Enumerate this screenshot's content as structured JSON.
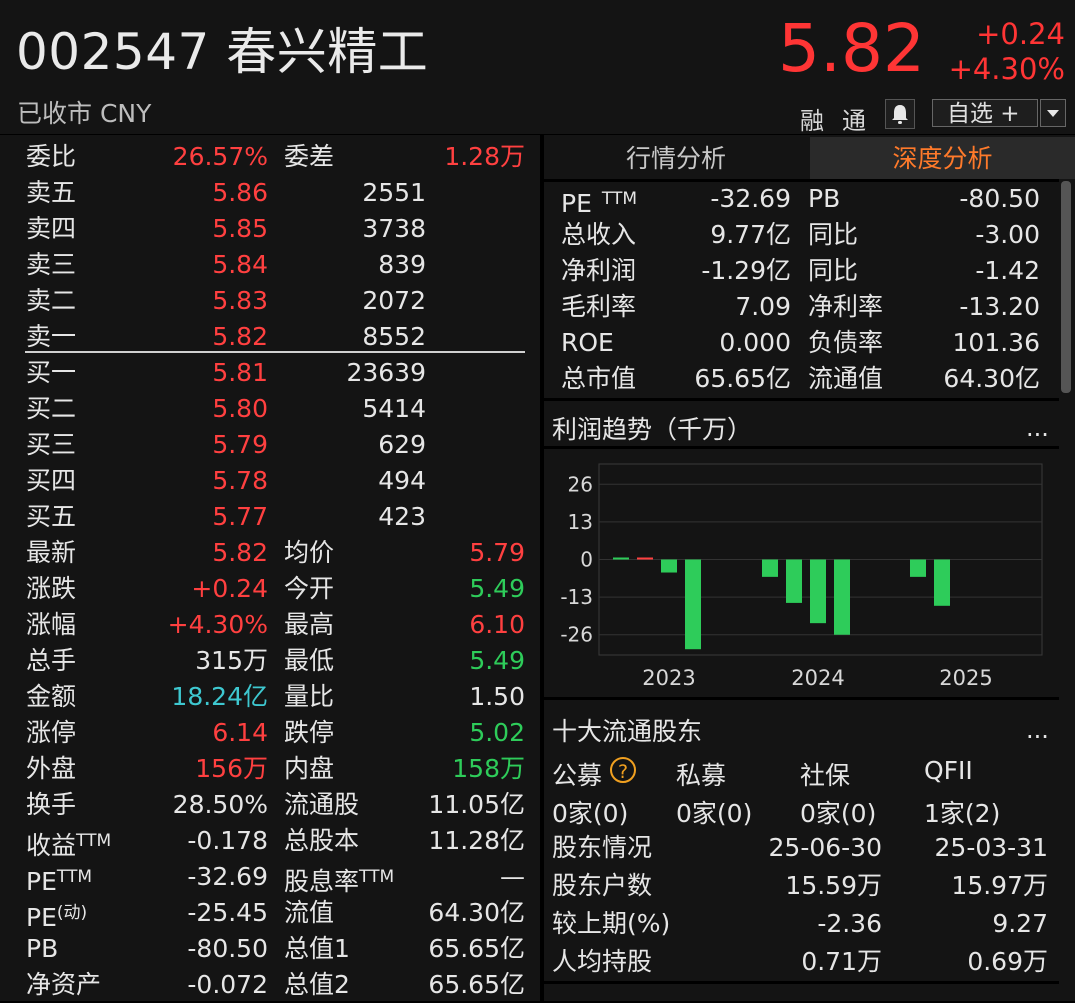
{
  "header": {
    "title": "002547 春兴精工",
    "subtitle": "已收市 CNY",
    "price": "5.82",
    "change": "+0.24",
    "change_pct": "+4.30%",
    "rong": "融",
    "tong": "通",
    "watchlist_label": "自选 +"
  },
  "book": {
    "weibi_label": "委比",
    "weibi_value": "26.57%",
    "weicha_label": "委差",
    "weicha_value": "1.28万",
    "asks": [
      {
        "label": "卖五",
        "price": "5.86",
        "qty": "2551"
      },
      {
        "label": "卖四",
        "price": "5.85",
        "qty": "3738"
      },
      {
        "label": "卖三",
        "price": "5.84",
        "qty": "839"
      },
      {
        "label": "卖二",
        "price": "5.83",
        "qty": "2072"
      },
      {
        "label": "卖一",
        "price": "5.82",
        "qty": "8552"
      }
    ],
    "bids": [
      {
        "label": "买一",
        "price": "5.81",
        "qty": "23639"
      },
      {
        "label": "买二",
        "price": "5.80",
        "qty": "5414"
      },
      {
        "label": "买三",
        "price": "5.79",
        "qty": "629"
      },
      {
        "label": "买四",
        "price": "5.78",
        "qty": "494"
      },
      {
        "label": "买五",
        "price": "5.77",
        "qty": "423"
      }
    ]
  },
  "stats": [
    {
      "l1": "最新",
      "v1": "5.82",
      "c1": "red",
      "l2": "均价",
      "v2": "5.79",
      "c2": "red"
    },
    {
      "l1": "涨跌",
      "v1": "+0.24",
      "c1": "red",
      "l2": "今开",
      "v2": "5.49",
      "c2": "green"
    },
    {
      "l1": "涨幅",
      "v1": "+4.30%",
      "c1": "red",
      "l2": "最高",
      "v2": "6.10",
      "c2": "red"
    },
    {
      "l1": "总手",
      "v1": "315万",
      "c1": "white",
      "l2": "最低",
      "v2": "5.49",
      "c2": "green"
    },
    {
      "l1": "金额",
      "v1": "18.24亿",
      "c1": "cyan",
      "l2": "量比",
      "v2": "1.50",
      "c2": "white"
    },
    {
      "l1": "涨停",
      "v1": "6.14",
      "c1": "red",
      "l2": "跌停",
      "v2": "5.02",
      "c2": "green"
    },
    {
      "l1": "外盘",
      "v1": "156万",
      "c1": "red",
      "l2": "内盘",
      "v2": "158万",
      "c2": "green"
    },
    {
      "l1": "换手",
      "v1": "28.50%",
      "c1": "white",
      "l2": "流通股",
      "v2": "11.05亿",
      "c2": "white"
    },
    {
      "l1": "收益",
      "s1": "TTM",
      "v1": "-0.178",
      "c1": "white",
      "l2": "总股本",
      "v2": "11.28亿",
      "c2": "white"
    },
    {
      "l1": "PE",
      "s1": "TTM",
      "v1": "-32.69",
      "c1": "white",
      "l2": "股息率",
      "s2": "TTM",
      "v2": "—",
      "c2": "white"
    },
    {
      "l1": "PE",
      "s1": "(动)",
      "v1": "-25.45",
      "c1": "white",
      "l2": "流值",
      "v2": "64.30亿",
      "c2": "white"
    },
    {
      "l1": "PB",
      "v1": "-80.50",
      "c1": "white",
      "l2": "总值1",
      "v2": "65.65亿",
      "c2": "white"
    },
    {
      "l1": "净资产",
      "v1": "-0.072",
      "c1": "white",
      "l2": "总值2",
      "v2": "65.65亿",
      "c2": "white"
    }
  ],
  "tabs": {
    "quote": "行情分析",
    "deep": "深度分析"
  },
  "fundamentals": [
    {
      "a": "PE",
      "as": "TTM",
      "b": "-32.69",
      "c": "PB",
      "d": "-80.50"
    },
    {
      "a": "总收入",
      "b": "9.77亿",
      "c": "同比",
      "d": "-3.00"
    },
    {
      "a": "净利润",
      "b": "-1.29亿",
      "c": "同比",
      "d": "-1.42"
    },
    {
      "a": "毛利率",
      "b": "7.09",
      "c": "净利率",
      "d": "-13.20"
    },
    {
      "a": "ROE",
      "b": "0.000",
      "c": "负债率",
      "d": "101.36"
    },
    {
      "a": "总市值",
      "b": "65.65亿",
      "c": "流通值",
      "d": "64.30亿"
    }
  ],
  "profit_section": {
    "title": "利润趋势（千万）",
    "more": "..."
  },
  "chart_data": {
    "type": "bar",
    "ylim": [
      -33,
      33
    ],
    "yticks": [
      "26",
      "13",
      "0",
      "-13",
      "-26"
    ],
    "ytick_values": [
      26,
      13,
      0,
      -13,
      -26
    ],
    "xlabels": [
      "2023",
      "2024",
      "2025"
    ],
    "values": [
      0.3,
      0.4,
      -4.5,
      -31,
      -6,
      -15,
      -22,
      -26,
      -6,
      -16
    ],
    "colors": [
      "#2ecc5a",
      "#ff4040",
      "#2ecc5a",
      "#2ecc5a",
      "#2ecc5a",
      "#2ecc5a",
      "#2ecc5a",
      "#2ecc5a",
      "#2ecc5a",
      "#2ecc5a"
    ]
  },
  "holders_section": {
    "title": "十大流通股东",
    "more": "...",
    "cats": [
      "公募",
      "私募",
      "社保",
      "QFII"
    ],
    "help": "?",
    "counts": [
      "0家(0)",
      "0家(0)",
      "0家(0)",
      "1家(2)"
    ],
    "rows": [
      {
        "k": "股东情况",
        "m": "25-06-30",
        "n": "25-03-31"
      },
      {
        "k": "股东户数",
        "m": "15.59万",
        "n": "15.97万"
      },
      {
        "k": "较上期(%)",
        "m": "-2.36",
        "n": "9.27"
      },
      {
        "k": "人均持股",
        "m": "0.71万",
        "n": "0.69万"
      }
    ]
  }
}
